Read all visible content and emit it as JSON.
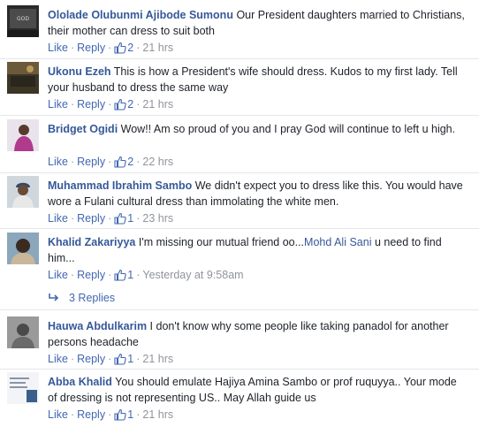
{
  "labels": {
    "like": "Like",
    "reply": "Reply",
    "dot": "·"
  },
  "colors": {
    "name": "#365899",
    "action": "#4267b2",
    "meta": "#90949c",
    "text": "#1d2129",
    "divider": "#e5e6e9"
  },
  "comments": [
    {
      "name": "Ololade Olubunmi Ajibode Sumonu",
      "text": "Our President daughters married to Christians, their mother can dress to suit both",
      "likes": "2",
      "time": "21 hrs"
    },
    {
      "name": "Ukonu Ezeh",
      "text": "This is how a President's wife should dress. Kudos to my first lady. Tell your husband to dress the same way",
      "likes": "2",
      "time": "21 hrs"
    },
    {
      "name": "Bridget Ogidi",
      "text": "Wow!! Am so proud of you and I pray God will continue to left u high.",
      "likes": "2",
      "time": "22 hrs"
    },
    {
      "name": "Muhammad Ibrahim Sambo",
      "text": "We didn't expect you to dress like this. You would have wore a Fulani cultural dress than immolating the white men.",
      "likes": "1",
      "time": "23 hrs"
    },
    {
      "name": "Khalid Zakariyya",
      "text_before": "I'm missing our mutual friend oo...",
      "mention": "Mohd Ali Sani",
      "text_after": " u need to find him...",
      "likes": "1",
      "time": "Yesterday at 9:58am",
      "replies": "3 Replies"
    },
    {
      "name": "Hauwa Abdulkarim",
      "text": "I don't know why some people like taking panadol for another persons headache",
      "likes": "1",
      "time": "21 hrs"
    },
    {
      "name": "Abba Khalid",
      "text": "You should emulate Hajiya Amina Sambo or prof ruquyya.. Your mode of dressing is not representing US.. May Allah guide us",
      "likes": "1",
      "time": "21 hrs"
    }
  ]
}
